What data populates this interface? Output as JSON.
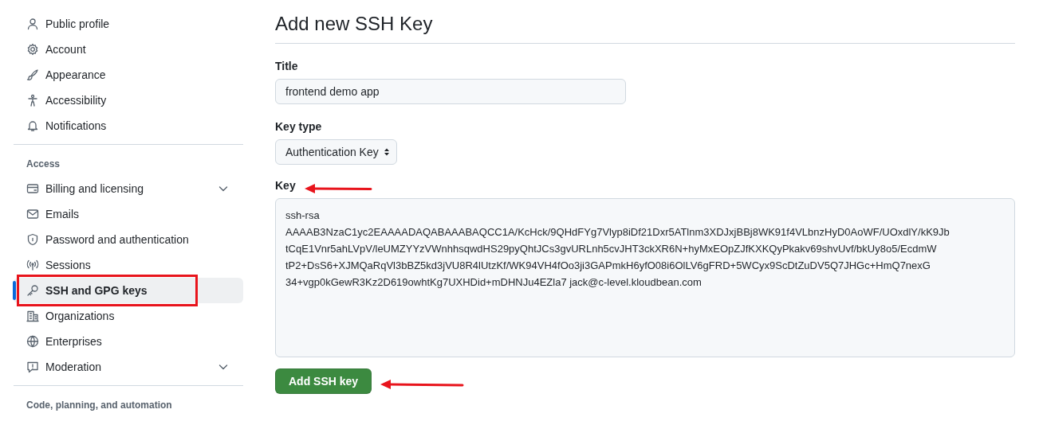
{
  "sidebar": {
    "groups": [
      {
        "items": [
          {
            "label": "Public profile",
            "selected": false,
            "expandable": false
          },
          {
            "label": "Account",
            "selected": false,
            "expandable": false
          },
          {
            "label": "Appearance",
            "selected": false,
            "expandable": false
          },
          {
            "label": "Accessibility",
            "selected": false,
            "expandable": false
          },
          {
            "label": "Notifications",
            "selected": false,
            "expandable": false
          }
        ]
      },
      {
        "heading": "Access",
        "items": [
          {
            "label": "Billing and licensing",
            "selected": false,
            "expandable": true
          },
          {
            "label": "Emails",
            "selected": false,
            "expandable": false
          },
          {
            "label": "Password and authentication",
            "selected": false,
            "expandable": false
          },
          {
            "label": "Sessions",
            "selected": false,
            "expandable": false
          },
          {
            "label": "SSH and GPG keys",
            "selected": true,
            "expandable": false
          },
          {
            "label": "Organizations",
            "selected": false,
            "expandable": false
          },
          {
            "label": "Enterprises",
            "selected": false,
            "expandable": false
          },
          {
            "label": "Moderation",
            "selected": false,
            "expandable": true
          }
        ]
      },
      {
        "heading": "Code, planning, and automation"
      }
    ]
  },
  "form": {
    "title": "Add new SSH Key",
    "title_field": {
      "label": "Title",
      "value": "frontend demo app"
    },
    "key_type": {
      "label": "Key type",
      "value": "Authentication Key"
    },
    "key": {
      "label": "Key",
      "value": "ssh-rsa\nAAAAB3NzaC1yc2EAAAADAQABAAABAQCC1A/KcHck/9QHdFYg7Vlyp8iDf21Dxr5ATlnm3XDJxjBBj8WK91f4VLbnzHyD0AoWF/UOxdlY/kK9Jb\ntCqE1Vnr5ahLVpV/leUMZYYzVWnhhsqwdHS29pyQhtJCs3gvURLnh5cvJHT3ckXR6N+hyMxEOpZJfKXKQyPkakv69shvUvf/bkUy8o5/EcdmW\ntP2+DsS6+XJMQaRqVl3bBZ5kd3jVU8R4lUtzKf/WK94VH4fOo3ji3GAPmkH6yfO08i6OlLV6gFRD+5WCyx9ScDtZuDV5Q7JHGc+HmQ7nexG\n34+vgp0kGewR3Kz2D619owhtKg7UXHDid+mDHNJu4EZla7 jack@c-level.kloudbean.com"
    },
    "submit": "Add SSH key"
  }
}
